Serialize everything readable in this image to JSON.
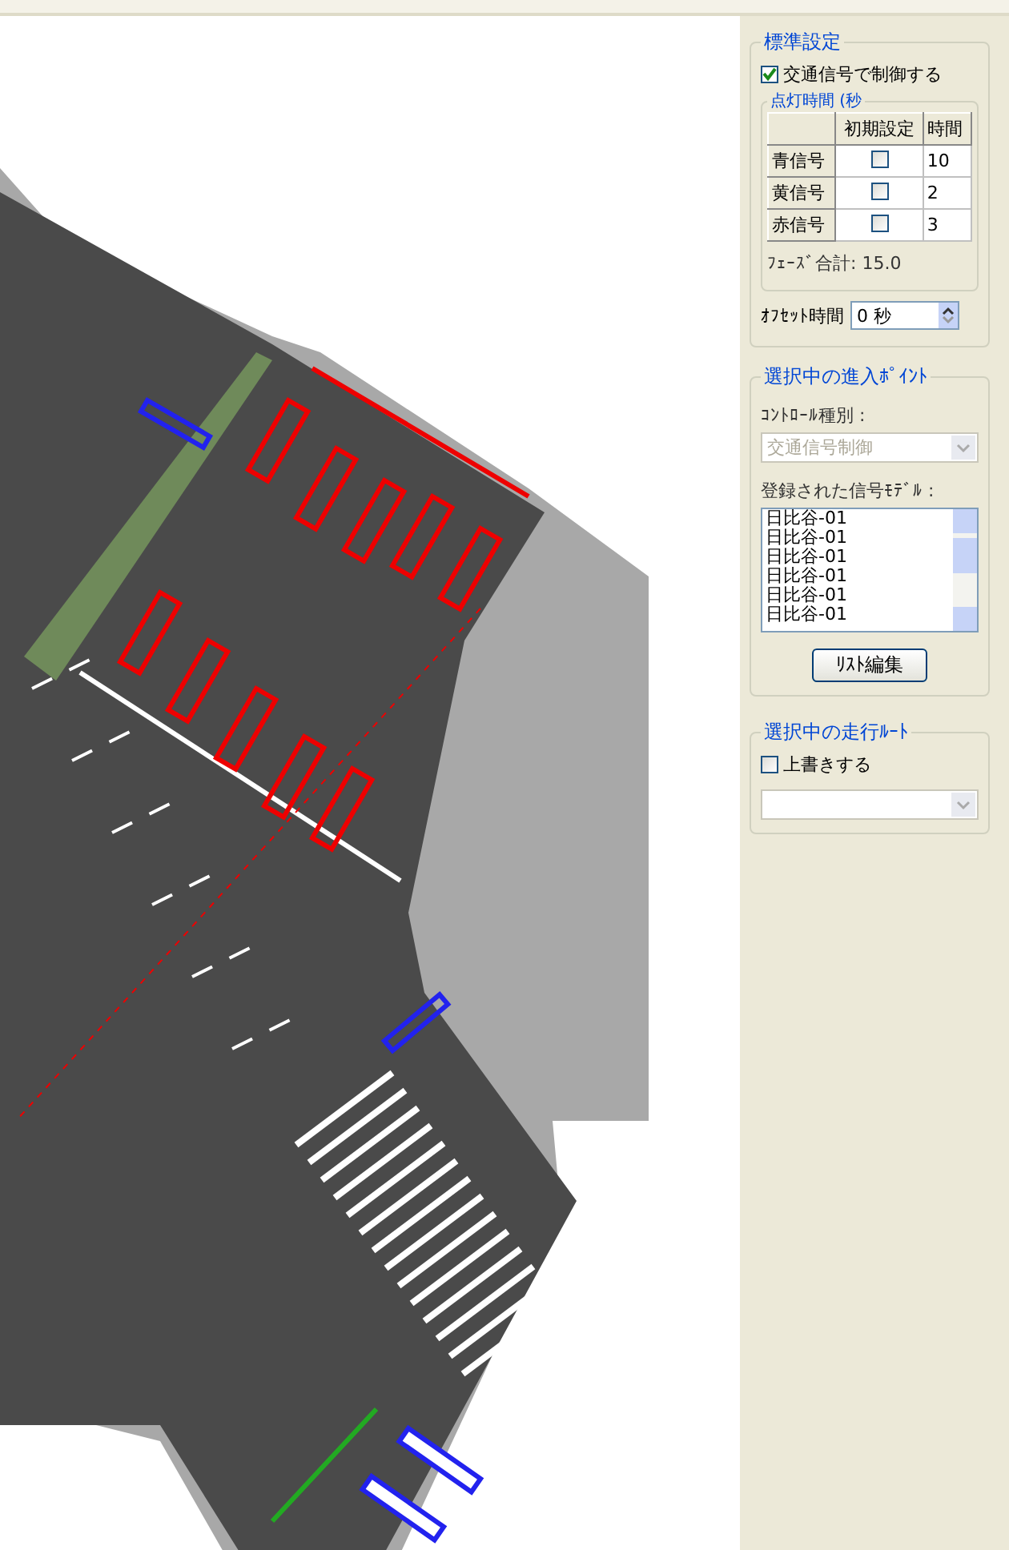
{
  "standard_settings": {
    "title": "標準設定",
    "control_by_signal": {
      "label": "交通信号で制御する",
      "checked": true
    },
    "lighting_time": {
      "title": "点灯時間 (秒",
      "columns": [
        "初期設定",
        "時間"
      ],
      "rows": [
        {
          "name": "青信号",
          "default": false,
          "time": "10"
        },
        {
          "name": "黄信号",
          "default": false,
          "time": "2"
        },
        {
          "name": "赤信号",
          "default": false,
          "time": "3"
        }
      ]
    },
    "phase_total": "ﾌｪｰｽﾞ合計: 15.0",
    "offset": {
      "label": "ｵﾌｾｯﾄ時間",
      "value": "0 秒"
    }
  },
  "entry_point": {
    "title": "選択中の進入ﾎﾟｲﾝﾄ",
    "control_type_label": "ｺﾝﾄﾛｰﾙ種別 :",
    "control_type": {
      "value": "交通信号制御",
      "disabled": true
    },
    "models_label": "登録された信号ﾓﾃﾞﾙ :",
    "models": [
      "日比谷-01",
      "日比谷-01",
      "日比谷-01",
      "日比谷-01",
      "日比谷-01",
      "日比谷-01"
    ],
    "edit_button": "ﾘｽﾄ編集"
  },
  "route": {
    "title": "選択中の走行ﾙｰﾄ",
    "override": {
      "label": "上書きする",
      "checked": false
    },
    "route_select": {
      "disabled": true
    }
  }
}
